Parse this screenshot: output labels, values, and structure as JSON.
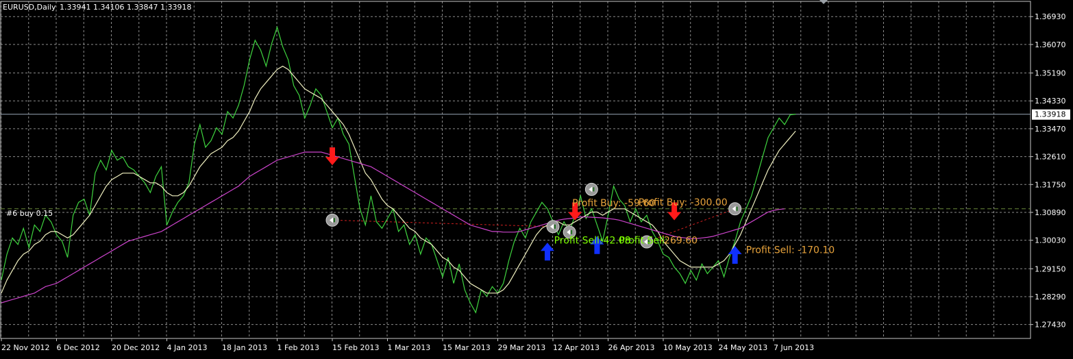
{
  "header": {
    "symbol": "EURUSD,Daily",
    "ohlc": "1.33941 1.34106 1.33847 1.33918"
  },
  "order_line_label": "#6 buy 0.15",
  "current_price_label": "1.33918",
  "colors": {
    "background": "#000000",
    "grid": "#c8c8c8",
    "price": "#3fd43f",
    "ma_fast": "#f0f0c0",
    "ma_slow": "#cc44cc",
    "order_line": "#6a8a3a",
    "sell_arrow": "#ff1a1a",
    "buy_arrow": "#1030ff",
    "profit_buy": "#e8a33b",
    "profit_sell": "#7cfc00"
  },
  "chart_data": {
    "type": "line",
    "title": "EURUSD,Daily",
    "ylim": [
      1.27,
      1.374
    ],
    "y_ticks": [
      "1.36930",
      "1.36070",
      "1.35190",
      "1.34330",
      "1.33470",
      "1.32610",
      "1.31750",
      "1.30890",
      "1.30030",
      "1.29150",
      "1.28290",
      "1.27430"
    ],
    "x_ticks": [
      "22 Nov 2012",
      "6 Dec 2012",
      "20 Dec 2012",
      "4 Jan 2013",
      "18 Jan 2013",
      "1 Feb 2013",
      "15 Feb 2013",
      "1 Mar 2013",
      "15 Mar 2013",
      "29 Mar 2013",
      "12 Apr 2013",
      "26 Apr 2013",
      "10 May 2013",
      "24 May 2013",
      "7 Jun 2013"
    ],
    "x_tick_index": [
      0,
      10,
      20,
      30,
      40,
      50,
      60,
      70,
      80,
      90,
      100,
      110,
      120,
      130,
      140
    ],
    "grid": true,
    "current_price": 1.33918,
    "order_price": 1.31,
    "series": [
      {
        "role": "price",
        "values": [
          1.288,
          1.296,
          1.301,
          1.299,
          1.304,
          1.298,
          1.305,
          1.303,
          1.308,
          1.306,
          1.302,
          1.3,
          1.295,
          1.308,
          1.312,
          1.313,
          1.308,
          1.321,
          1.325,
          1.322,
          1.328,
          1.325,
          1.326,
          1.323,
          1.322,
          1.32,
          1.318,
          1.315,
          1.32,
          1.323,
          1.305,
          1.309,
          1.312,
          1.314,
          1.318,
          1.33,
          1.336,
          1.329,
          1.331,
          1.335,
          1.333,
          1.34,
          1.338,
          1.342,
          1.348,
          1.356,
          1.362,
          1.359,
          1.354,
          1.361,
          1.366,
          1.36,
          1.356,
          1.348,
          1.345,
          1.338,
          1.342,
          1.347,
          1.345,
          1.34,
          1.335,
          1.338,
          1.333,
          1.33,
          1.32,
          1.31,
          1.305,
          1.314,
          1.306,
          1.304,
          1.307,
          1.31,
          1.303,
          1.305,
          1.299,
          1.302,
          1.296,
          1.301,
          1.299,
          1.294,
          1.289,
          1.295,
          1.287,
          1.293,
          1.285,
          1.281,
          1.278,
          1.285,
          1.283,
          1.286,
          1.284,
          1.287,
          1.294,
          1.3,
          1.304,
          1.301,
          1.306,
          1.309,
          1.312,
          1.31,
          1.306,
          1.302,
          1.306,
          1.303,
          1.308,
          1.314,
          1.307,
          1.31,
          1.305,
          1.3,
          1.308,
          1.317,
          1.313,
          1.311,
          1.306,
          1.31,
          1.306,
          1.308,
          1.303,
          1.3,
          1.296,
          1.295,
          1.292,
          1.29,
          1.287,
          1.291,
          1.288,
          1.293,
          1.29,
          1.292,
          1.294,
          1.289,
          1.295,
          1.3,
          1.306,
          1.31,
          1.314,
          1.32,
          1.326,
          1.332,
          1.335,
          1.338,
          1.336,
          1.339,
          1.3392
        ]
      },
      {
        "role": "ma_fast",
        "values": [
          1.284,
          1.288,
          1.291,
          1.294,
          1.296,
          1.297,
          1.299,
          1.3,
          1.302,
          1.303,
          1.303,
          1.302,
          1.301,
          1.302,
          1.304,
          1.306,
          1.308,
          1.311,
          1.314,
          1.317,
          1.319,
          1.32,
          1.321,
          1.321,
          1.321,
          1.32,
          1.319,
          1.318,
          1.318,
          1.317,
          1.315,
          1.314,
          1.314,
          1.315,
          1.317,
          1.32,
          1.323,
          1.325,
          1.327,
          1.328,
          1.329,
          1.331,
          1.332,
          1.334,
          1.337,
          1.34,
          1.344,
          1.347,
          1.349,
          1.351,
          1.353,
          1.354,
          1.353,
          1.351,
          1.349,
          1.347,
          1.346,
          1.345,
          1.344,
          1.342,
          1.34,
          1.338,
          1.336,
          1.333,
          1.329,
          1.325,
          1.321,
          1.319,
          1.316,
          1.313,
          1.311,
          1.31,
          1.308,
          1.306,
          1.304,
          1.303,
          1.301,
          1.3,
          1.299,
          1.297,
          1.295,
          1.294,
          1.292,
          1.291,
          1.289,
          1.287,
          1.286,
          1.285,
          1.284,
          1.284,
          1.284,
          1.285,
          1.287,
          1.29,
          1.293,
          1.296,
          1.299,
          1.302,
          1.304,
          1.305,
          1.306,
          1.306,
          1.305,
          1.305,
          1.306,
          1.307,
          1.308,
          1.309,
          1.309,
          1.308,
          1.309,
          1.31,
          1.31,
          1.31,
          1.309,
          1.308,
          1.307,
          1.306,
          1.305,
          1.303,
          1.3,
          1.298,
          1.296,
          1.294,
          1.293,
          1.292,
          1.292,
          1.292,
          1.292,
          1.292,
          1.293,
          1.294,
          1.296,
          1.299,
          1.302,
          1.306,
          1.31,
          1.314,
          1.318,
          1.322,
          1.325,
          1.328,
          1.33,
          1.332,
          1.334
        ]
      },
      {
        "role": "ma_slow",
        "values": [
          1.281,
          1.2815,
          1.282,
          1.2825,
          1.283,
          1.2835,
          1.284,
          1.285,
          1.286,
          1.2865,
          1.287,
          1.288,
          1.289,
          1.29,
          1.291,
          1.292,
          1.293,
          1.294,
          1.295,
          1.296,
          1.297,
          1.298,
          1.299,
          1.3,
          1.3005,
          1.301,
          1.3015,
          1.302,
          1.3025,
          1.303,
          1.304,
          1.305,
          1.306,
          1.307,
          1.308,
          1.309,
          1.31,
          1.311,
          1.312,
          1.313,
          1.314,
          1.315,
          1.316,
          1.317,
          1.3185,
          1.32,
          1.321,
          1.322,
          1.323,
          1.324,
          1.325,
          1.3255,
          1.326,
          1.3265,
          1.327,
          1.3275,
          1.3275,
          1.3275,
          1.3275,
          1.327,
          1.3265,
          1.326,
          1.3255,
          1.325,
          1.3245,
          1.324,
          1.3235,
          1.323,
          1.322,
          1.321,
          1.32,
          1.319,
          1.318,
          1.317,
          1.316,
          1.315,
          1.314,
          1.313,
          1.312,
          1.311,
          1.31,
          1.309,
          1.308,
          1.307,
          1.306,
          1.305,
          1.3045,
          1.304,
          1.3035,
          1.303,
          1.303,
          1.3028,
          1.3028,
          1.3028,
          1.303,
          1.3035,
          1.304,
          1.3045,
          1.305,
          1.3055,
          1.306,
          1.3065,
          1.3068,
          1.307,
          1.3072,
          1.3075,
          1.3075,
          1.3074,
          1.3073,
          1.3072,
          1.307,
          1.3068,
          1.3065,
          1.306,
          1.3055,
          1.305,
          1.3045,
          1.304,
          1.3035,
          1.303,
          1.3025,
          1.302,
          1.3015,
          1.3012,
          1.301,
          1.3008,
          1.3008,
          1.301,
          1.3012,
          1.3015,
          1.302,
          1.3025,
          1.303,
          1.3035,
          1.304,
          1.305,
          1.306,
          1.307,
          1.308,
          1.309,
          1.3095,
          1.3098,
          1.31
        ]
      }
    ],
    "signals": [
      {
        "type": "sell",
        "i": 60,
        "price": 1.326
      },
      {
        "type": "sell",
        "i": 104,
        "price": 1.309
      },
      {
        "type": "sell",
        "i": 122,
        "price": 1.309
      },
      {
        "type": "buy",
        "i": 99,
        "price": 1.297
      },
      {
        "type": "buy",
        "i": 108,
        "price": 1.299
      },
      {
        "type": "buy",
        "i": 133,
        "price": 1.296
      }
    ],
    "trade_markers": [
      {
        "i": 60,
        "price": 1.3065
      },
      {
        "i": 100,
        "price": 1.3045
      },
      {
        "i": 103,
        "price": 1.3028
      },
      {
        "i": 107,
        "price": 1.316
      },
      {
        "i": 117,
        "price": 1.2998
      },
      {
        "i": 133,
        "price": 1.31
      }
    ],
    "trade_lines": [
      {
        "from": 0,
        "to": 1
      },
      {
        "from": 4,
        "to": 5
      }
    ],
    "annotations": [
      {
        "text": "Profit Buy: -59.60",
        "i": 103.5,
        "price": 1.3108,
        "role": "profit_buy"
      },
      {
        "text": "Profit Buy: -300.00",
        "i": 115.5,
        "price": 1.311,
        "role": "profit_buy"
      },
      {
        "text": "Profit Sell:",
        "i": 100.2,
        "price": 1.2993,
        "role": "profit_sell"
      },
      {
        "text": "-42.08",
        "i": 108.5,
        "price": 1.2993,
        "role": "profit_sell"
      },
      {
        "text": "Profit Sell:",
        "i": 112.0,
        "price": 1.2993,
        "role": "profit_sell"
      },
      {
        "text": "-269.60",
        "i": 119.5,
        "price": 1.2993,
        "role": "profit_buy"
      },
      {
        "text": "Profit Sell: -170.10",
        "i": 135.0,
        "price": 1.2963,
        "role": "profit_buy"
      }
    ]
  }
}
